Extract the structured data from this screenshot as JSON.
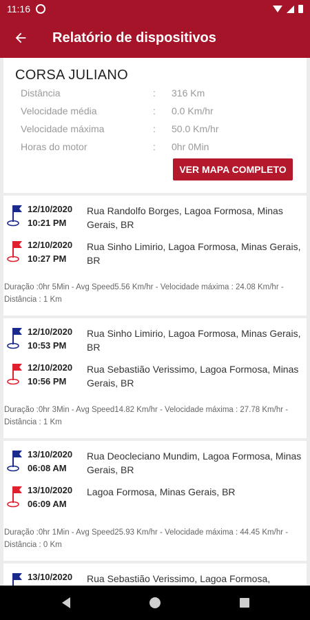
{
  "status_bar": {
    "time": "11:16"
  },
  "header": {
    "title": "Relatório de dispositivos",
    "back_icon": "arrow-back-icon"
  },
  "summary": {
    "device_name": "CORSA JULIANO",
    "rows": [
      {
        "label": "Distância",
        "sep": ":",
        "value": "316 Km"
      },
      {
        "label": "Velocidade média",
        "sep": ":",
        "value": "0.0 Km/hr"
      },
      {
        "label": "Velocidade máxima",
        "sep": ":",
        "value": "50.0 Km/hr"
      },
      {
        "label": "Horas do motor",
        "sep": ":",
        "value": "0hr 0Min"
      }
    ],
    "map_button": "VER MAPA COMPLETO"
  },
  "colors": {
    "primary": "#a6142a",
    "start_flag": "#1a2a8c",
    "end_flag": "#e0202f"
  },
  "trips": [
    {
      "start": {
        "date": "12/10/2020",
        "time": "10:21 PM",
        "address": "Rua Randolfo Borges, Lagoa Formosa, Minas Gerais, BR"
      },
      "end": {
        "date": "12/10/2020",
        "time": "10:27 PM",
        "address": "Rua Sinho Limirio, Lagoa Formosa, Minas Gerais, BR"
      },
      "summary": "Duração :0hr 5Min - Avg Speed5.56 Km/hr - Velocidade máxima : 24.08 Km/hr - Distância : 1 Km"
    },
    {
      "start": {
        "date": "12/10/2020",
        "time": "10:53 PM",
        "address": "Rua Sinho Limirio, Lagoa Formosa, Minas Gerais, BR"
      },
      "end": {
        "date": "12/10/2020",
        "time": "10:56 PM",
        "address": "Rua Sebastião Verissimo, Lagoa Formosa, Minas Gerais, BR"
      },
      "summary": "Duração :0hr 3Min - Avg Speed14.82 Km/hr - Velocidade máxima : 27.78 Km/hr - Distância : 1 Km"
    },
    {
      "start": {
        "date": "13/10/2020",
        "time": "06:08 AM",
        "address": "Rua Deocleciano Mundim, Lagoa Formosa, Minas Gerais, BR"
      },
      "end": {
        "date": "13/10/2020",
        "time": "06:09 AM",
        "address": "Lagoa Formosa, Minas Gerais, BR"
      },
      "summary": "Duração :0hr 1Min - Avg Speed25.93 Km/hr - Velocidade máxima : 44.45 Km/hr - Distância : 0 Km"
    },
    {
      "start": {
        "date": "13/10/2020",
        "time": "",
        "address": "Rua Sebastião Verissimo, Lagoa Formosa,"
      }
    }
  ]
}
